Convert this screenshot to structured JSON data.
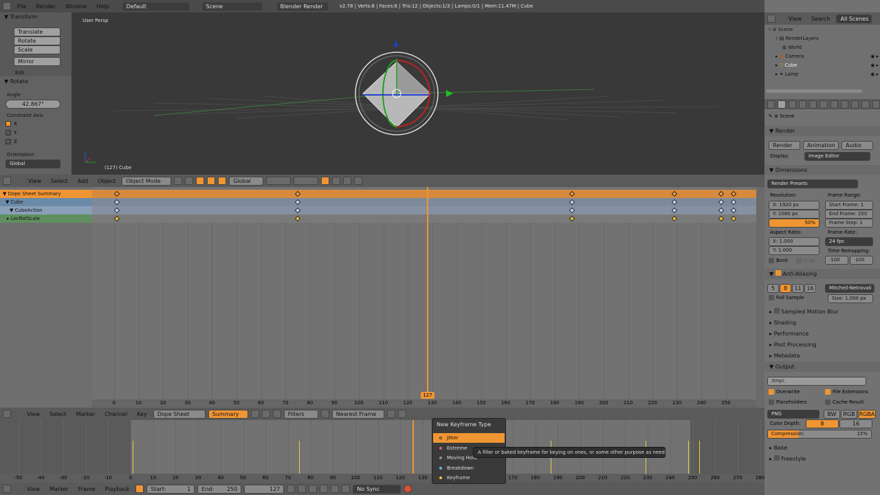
{
  "topbar": {
    "menus": [
      "File",
      "Render",
      "Window",
      "Help"
    ],
    "layout": "Default",
    "scene": "Scene",
    "engine": "Blender Render",
    "stats": "v2.78 | Verts:8 | Faces:6 | Tris:12 | Objects:1/3 | Lamps:0/1 | Mem:11.47M | Cube"
  },
  "tool_shelf": {
    "transform_title": "Transform",
    "buttons": [
      "Translate",
      "Rotate",
      "Scale",
      "Mirror"
    ],
    "edit_label": "Edit",
    "rotate_title": "Rotate",
    "angle_label": "Angle",
    "angle_value": "42.867°",
    "constraint_label": "Constraint Axis",
    "axes": [
      {
        "name": "X",
        "checked": true
      },
      {
        "name": "Y",
        "checked": false
      },
      {
        "name": "Z",
        "checked": false
      }
    ],
    "orientation_label": "Orientation",
    "orientation_value": "Global"
  },
  "viewport": {
    "view_name": "User Persp",
    "object_label": "(127) Cube",
    "header_menus": [
      "View",
      "Select",
      "Add",
      "Object"
    ],
    "mode": "Object Mode",
    "orientation": "Global"
  },
  "dopesheet": {
    "channels": [
      "Dope Sheet Summary",
      "Cube",
      "CubeAction",
      "LocRotScale"
    ],
    "keyframes": [
      1,
      75,
      187,
      229,
      248,
      253
    ],
    "current_frame": "127",
    "ruler": [
      "0",
      "10",
      "20",
      "30",
      "40",
      "50",
      "60",
      "70",
      "80",
      "90",
      "100",
      "110",
      "120",
      "130",
      "140",
      "150",
      "160",
      "170",
      "180",
      "190",
      "200",
      "210",
      "220",
      "230",
      "240",
      "250"
    ],
    "header_menus": [
      "View",
      "Select",
      "Marker",
      "Channel",
      "Key"
    ],
    "editor_type": "Dope Sheet",
    "summary_label": "Summary",
    "filters_label": "Filters",
    "snap_mode": "Nearest Frame"
  },
  "timeline": {
    "ruler": [
      "-50",
      "-40",
      "-30",
      "-20",
      "-10",
      "0",
      "10",
      "20",
      "30",
      "40",
      "50",
      "60",
      "70",
      "80",
      "90",
      "100",
      "110",
      "120",
      "130",
      "140",
      "150",
      "160",
      "170",
      "180",
      "190",
      "200",
      "210",
      "220",
      "230",
      "240",
      "250",
      "260",
      "270",
      "280"
    ],
    "header_menus": [
      "View",
      "Marker",
      "Frame",
      "Playback"
    ],
    "start_label": "Start:",
    "start_value": "1",
    "end_label": "End:",
    "end_value": "250",
    "current_value": "127",
    "sync": "No Sync"
  },
  "keyframe_menu": {
    "title": "New Keyframe Type",
    "items": [
      {
        "label": "Jitter",
        "color": "#f0a040",
        "selected": true
      },
      {
        "label": "Extreme",
        "color": "#e06060",
        "selected": false
      },
      {
        "label": "Moving Hold",
        "color": "#909090",
        "selected": false
      },
      {
        "label": "Breakdown",
        "color": "#60c0e0",
        "selected": false
      },
      {
        "label": "Keyframe",
        "color": "#f0c040",
        "selected": false
      }
    ],
    "tooltip": "A filler or baked keyframe for keying on ones, or some other purpose as needed"
  },
  "outliner": {
    "tabs": [
      "View",
      "Search",
      "All Scenes"
    ],
    "items": [
      "Scene",
      "RenderLayers",
      "World",
      "Camera",
      "Cube",
      "Lamp"
    ]
  },
  "properties": {
    "context": "Scene",
    "render_title": "Render",
    "render_buttons": [
      "Render",
      "Animation",
      "Audio"
    ],
    "display_label": "Display:",
    "display_value": "Image Editor",
    "dimensions_title": "Dimensions",
    "render_presets": "Render Presets",
    "resolution_label": "Resolution:",
    "res_x": "X:  1920 px",
    "res_y": "Y:  1080 px",
    "res_pct": "50%",
    "frame_range_label": "Frame Range:",
    "start_frame": "Start Frame:  1",
    "end_frame": "End Frame:  250",
    "frame_step": "Frame Step:  1",
    "aspect_label": "Aspect Ratio:",
    "aspect_x": "X:  1.000",
    "aspect_y": "Y:  1.000",
    "frame_rate_label": "Frame Rate:",
    "frame_rate": "24 fps",
    "time_remap_label": "Time Remapping:",
    "time_old": "·100",
    "time_new": "·100",
    "border_label": "Bord",
    "crop_label": "Crop",
    "aa_title": "Anti-Aliasing",
    "aa_samples": [
      "5",
      "8",
      "11",
      "16"
    ],
    "aa_filter": "Mitchell-Netravali",
    "full_sample": "Full Sample",
    "size_value": "Size:  1.000 px",
    "panels": [
      "Sampled Motion Blur",
      "Shading",
      "Performance",
      "Post Processing",
      "Metadata"
    ],
    "output_title": "Output",
    "output_path": "/tmp\\",
    "overwrite": "Overwrite",
    "file_ext": "File Extensions",
    "placeholders": "Placeholders",
    "cache_result": "Cache Result",
    "format": "PNG",
    "color_modes": [
      "BW",
      "RGB",
      "RGBA"
    ],
    "color_depth_label": "Color Depth:",
    "depth_values": [
      "8",
      "16"
    ],
    "compression": "Compression:",
    "compression_value": "15%",
    "bake": "Bake",
    "freestyle": "Freestyle"
  },
  "colors": {
    "accent": "#f09533",
    "viewport_bg": "#393939",
    "panel_bg": "#727272"
  }
}
